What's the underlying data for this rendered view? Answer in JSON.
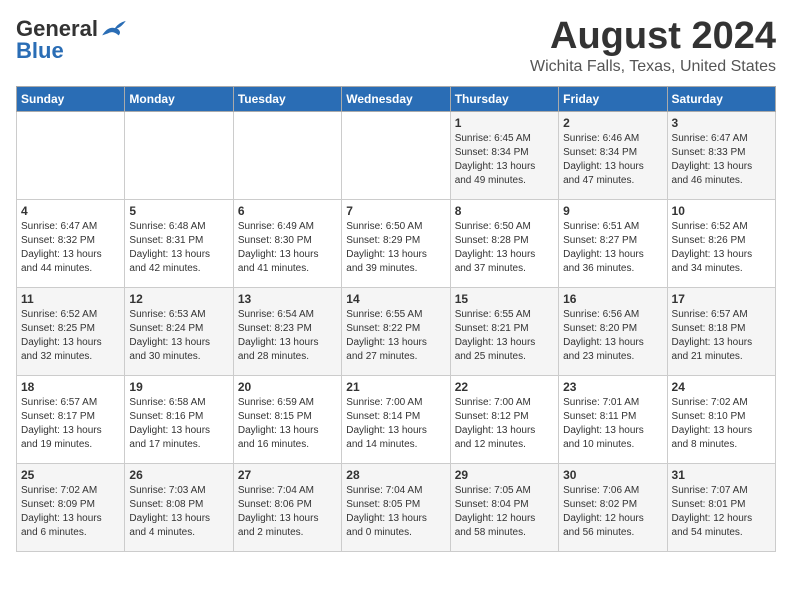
{
  "header": {
    "logo_general": "General",
    "logo_blue": "Blue",
    "month": "August 2024",
    "location": "Wichita Falls, Texas, United States"
  },
  "days_of_week": [
    "Sunday",
    "Monday",
    "Tuesday",
    "Wednesday",
    "Thursday",
    "Friday",
    "Saturday"
  ],
  "weeks": [
    [
      {
        "day": "",
        "sunrise": "",
        "sunset": "",
        "daylight": ""
      },
      {
        "day": "",
        "sunrise": "",
        "sunset": "",
        "daylight": ""
      },
      {
        "day": "",
        "sunrise": "",
        "sunset": "",
        "daylight": ""
      },
      {
        "day": "",
        "sunrise": "",
        "sunset": "",
        "daylight": ""
      },
      {
        "day": "1",
        "sunrise": "Sunrise: 6:45 AM",
        "sunset": "Sunset: 8:34 PM",
        "daylight": "Daylight: 13 hours and 49 minutes."
      },
      {
        "day": "2",
        "sunrise": "Sunrise: 6:46 AM",
        "sunset": "Sunset: 8:34 PM",
        "daylight": "Daylight: 13 hours and 47 minutes."
      },
      {
        "day": "3",
        "sunrise": "Sunrise: 6:47 AM",
        "sunset": "Sunset: 8:33 PM",
        "daylight": "Daylight: 13 hours and 46 minutes."
      }
    ],
    [
      {
        "day": "4",
        "sunrise": "Sunrise: 6:47 AM",
        "sunset": "Sunset: 8:32 PM",
        "daylight": "Daylight: 13 hours and 44 minutes."
      },
      {
        "day": "5",
        "sunrise": "Sunrise: 6:48 AM",
        "sunset": "Sunset: 8:31 PM",
        "daylight": "Daylight: 13 hours and 42 minutes."
      },
      {
        "day": "6",
        "sunrise": "Sunrise: 6:49 AM",
        "sunset": "Sunset: 8:30 PM",
        "daylight": "Daylight: 13 hours and 41 minutes."
      },
      {
        "day": "7",
        "sunrise": "Sunrise: 6:50 AM",
        "sunset": "Sunset: 8:29 PM",
        "daylight": "Daylight: 13 hours and 39 minutes."
      },
      {
        "day": "8",
        "sunrise": "Sunrise: 6:50 AM",
        "sunset": "Sunset: 8:28 PM",
        "daylight": "Daylight: 13 hours and 37 minutes."
      },
      {
        "day": "9",
        "sunrise": "Sunrise: 6:51 AM",
        "sunset": "Sunset: 8:27 PM",
        "daylight": "Daylight: 13 hours and 36 minutes."
      },
      {
        "day": "10",
        "sunrise": "Sunrise: 6:52 AM",
        "sunset": "Sunset: 8:26 PM",
        "daylight": "Daylight: 13 hours and 34 minutes."
      }
    ],
    [
      {
        "day": "11",
        "sunrise": "Sunrise: 6:52 AM",
        "sunset": "Sunset: 8:25 PM",
        "daylight": "Daylight: 13 hours and 32 minutes."
      },
      {
        "day": "12",
        "sunrise": "Sunrise: 6:53 AM",
        "sunset": "Sunset: 8:24 PM",
        "daylight": "Daylight: 13 hours and 30 minutes."
      },
      {
        "day": "13",
        "sunrise": "Sunrise: 6:54 AM",
        "sunset": "Sunset: 8:23 PM",
        "daylight": "Daylight: 13 hours and 28 minutes."
      },
      {
        "day": "14",
        "sunrise": "Sunrise: 6:55 AM",
        "sunset": "Sunset: 8:22 PM",
        "daylight": "Daylight: 13 hours and 27 minutes."
      },
      {
        "day": "15",
        "sunrise": "Sunrise: 6:55 AM",
        "sunset": "Sunset: 8:21 PM",
        "daylight": "Daylight: 13 hours and 25 minutes."
      },
      {
        "day": "16",
        "sunrise": "Sunrise: 6:56 AM",
        "sunset": "Sunset: 8:20 PM",
        "daylight": "Daylight: 13 hours and 23 minutes."
      },
      {
        "day": "17",
        "sunrise": "Sunrise: 6:57 AM",
        "sunset": "Sunset: 8:18 PM",
        "daylight": "Daylight: 13 hours and 21 minutes."
      }
    ],
    [
      {
        "day": "18",
        "sunrise": "Sunrise: 6:57 AM",
        "sunset": "Sunset: 8:17 PM",
        "daylight": "Daylight: 13 hours and 19 minutes."
      },
      {
        "day": "19",
        "sunrise": "Sunrise: 6:58 AM",
        "sunset": "Sunset: 8:16 PM",
        "daylight": "Daylight: 13 hours and 17 minutes."
      },
      {
        "day": "20",
        "sunrise": "Sunrise: 6:59 AM",
        "sunset": "Sunset: 8:15 PM",
        "daylight": "Daylight: 13 hours and 16 minutes."
      },
      {
        "day": "21",
        "sunrise": "Sunrise: 7:00 AM",
        "sunset": "Sunset: 8:14 PM",
        "daylight": "Daylight: 13 hours and 14 minutes."
      },
      {
        "day": "22",
        "sunrise": "Sunrise: 7:00 AM",
        "sunset": "Sunset: 8:12 PM",
        "daylight": "Daylight: 13 hours and 12 minutes."
      },
      {
        "day": "23",
        "sunrise": "Sunrise: 7:01 AM",
        "sunset": "Sunset: 8:11 PM",
        "daylight": "Daylight: 13 hours and 10 minutes."
      },
      {
        "day": "24",
        "sunrise": "Sunrise: 7:02 AM",
        "sunset": "Sunset: 8:10 PM",
        "daylight": "Daylight: 13 hours and 8 minutes."
      }
    ],
    [
      {
        "day": "25",
        "sunrise": "Sunrise: 7:02 AM",
        "sunset": "Sunset: 8:09 PM",
        "daylight": "Daylight: 13 hours and 6 minutes."
      },
      {
        "day": "26",
        "sunrise": "Sunrise: 7:03 AM",
        "sunset": "Sunset: 8:08 PM",
        "daylight": "Daylight: 13 hours and 4 minutes."
      },
      {
        "day": "27",
        "sunrise": "Sunrise: 7:04 AM",
        "sunset": "Sunset: 8:06 PM",
        "daylight": "Daylight: 13 hours and 2 minutes."
      },
      {
        "day": "28",
        "sunrise": "Sunrise: 7:04 AM",
        "sunset": "Sunset: 8:05 PM",
        "daylight": "Daylight: 13 hours and 0 minutes."
      },
      {
        "day": "29",
        "sunrise": "Sunrise: 7:05 AM",
        "sunset": "Sunset: 8:04 PM",
        "daylight": "Daylight: 12 hours and 58 minutes."
      },
      {
        "day": "30",
        "sunrise": "Sunrise: 7:06 AM",
        "sunset": "Sunset: 8:02 PM",
        "daylight": "Daylight: 12 hours and 56 minutes."
      },
      {
        "day": "31",
        "sunrise": "Sunrise: 7:07 AM",
        "sunset": "Sunset: 8:01 PM",
        "daylight": "Daylight: 12 hours and 54 minutes."
      }
    ]
  ]
}
